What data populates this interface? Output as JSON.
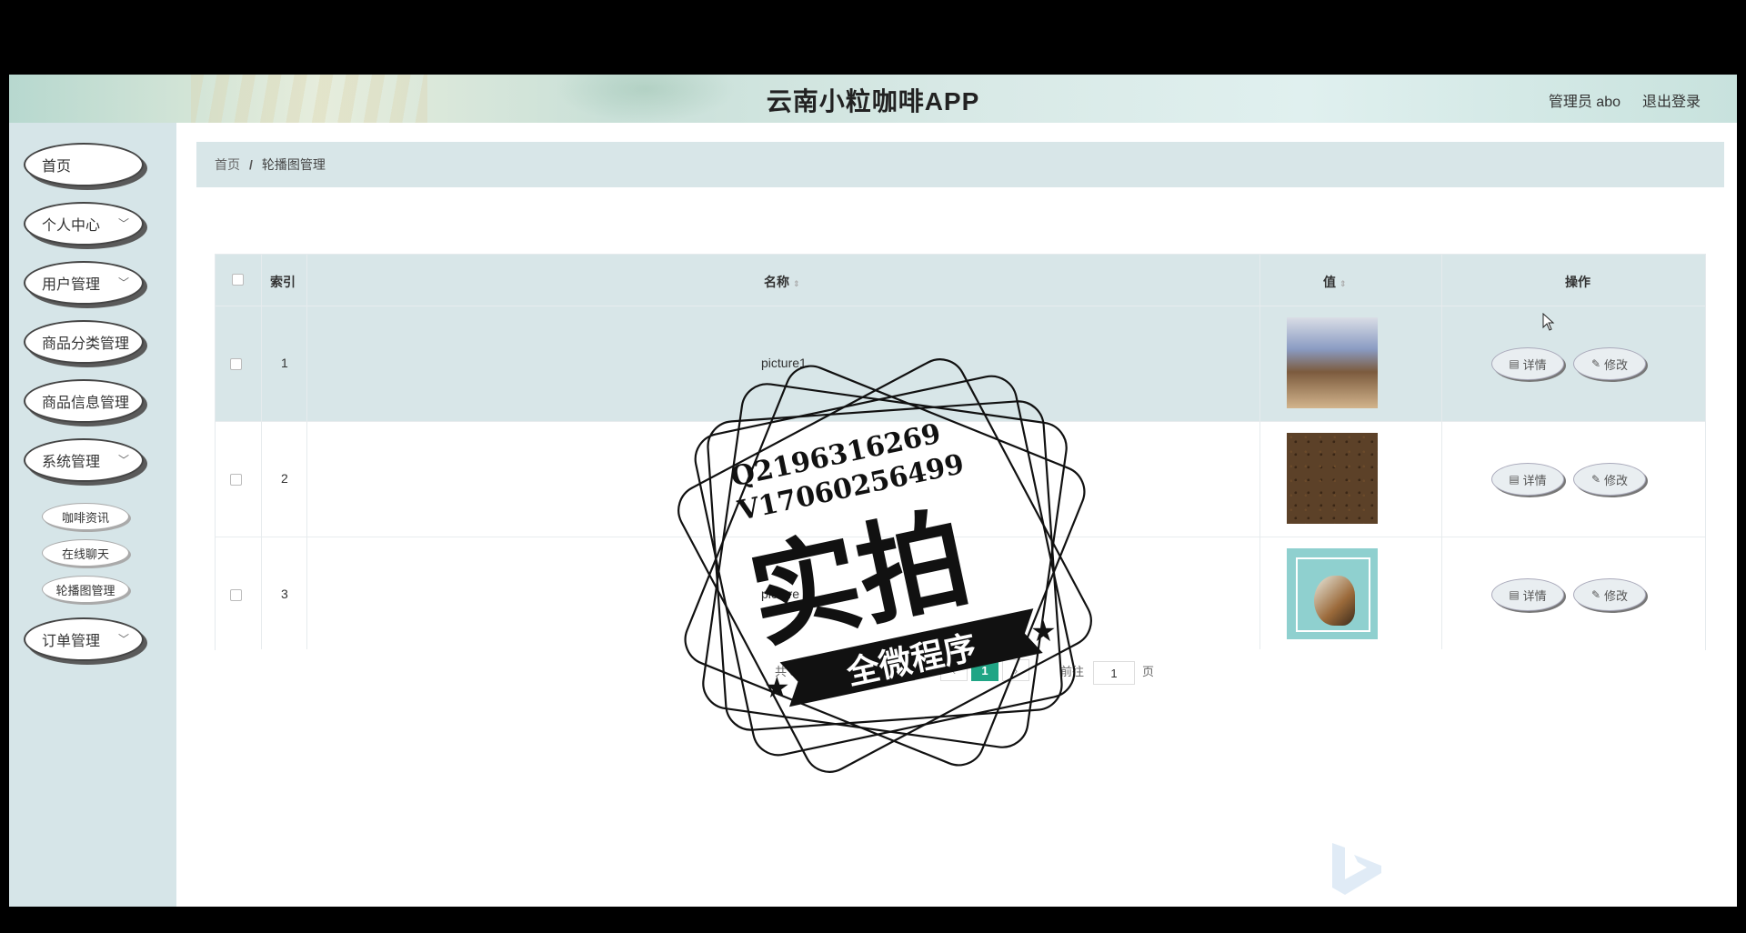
{
  "header": {
    "title": "云南小粒咖啡APP",
    "admin_label": "管理员 abo",
    "logout_label": "退出登录"
  },
  "sidebar": {
    "items": [
      {
        "label": "首页",
        "has_chevron": false
      },
      {
        "label": "个人中心",
        "has_chevron": true
      },
      {
        "label": "用户管理",
        "has_chevron": true
      },
      {
        "label": "商品分类管理",
        "has_chevron": false
      },
      {
        "label": "商品信息管理",
        "has_chevron": false
      },
      {
        "label": "系统管理",
        "has_chevron": true
      },
      {
        "label": "订单管理",
        "has_chevron": true
      }
    ],
    "sub_items": [
      "咖啡资讯",
      "在线聊天",
      "轮播图管理"
    ],
    "chevron_glyph": "﹀"
  },
  "breadcrumb": {
    "home": "首页",
    "separator": "/",
    "current": "轮播图管理"
  },
  "table": {
    "columns": {
      "index": "索引",
      "name": "名称",
      "value": "值",
      "actions": "操作"
    },
    "rows": [
      {
        "index": "1",
        "name": "picture1"
      },
      {
        "index": "2",
        "name": ""
      },
      {
        "index": "3",
        "name": "picture"
      }
    ],
    "detail_label": "详情",
    "edit_label": "修改"
  },
  "pagination": {
    "total": "共 3 条",
    "page_size": "10条/页",
    "current_page": "1",
    "goto_prefix": "前往",
    "goto_value": "1",
    "goto_suffix": "页"
  },
  "stamp": {
    "line1": "Q2196316269",
    "line2": "V17060256499",
    "big": "实拍",
    "ribbon": "全微程序"
  },
  "colors": {
    "sidebar_bg": "#d6e5e8",
    "table_header_bg": "#d8e6e8",
    "accent": "#20a585"
  }
}
